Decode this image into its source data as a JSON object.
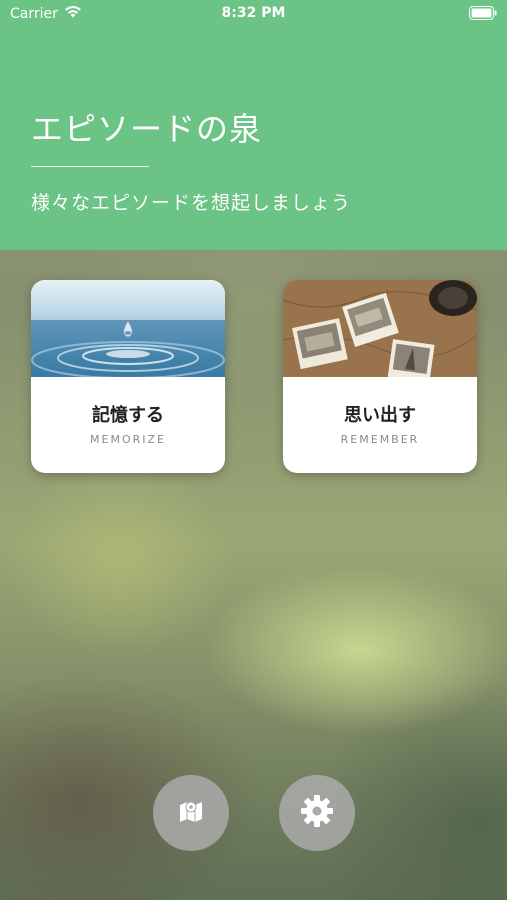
{
  "status_bar": {
    "carrier": "Carrier",
    "time": "8:32 PM"
  },
  "header": {
    "title": "エピソードの泉",
    "subtitle": "様々なエピソードを想起しましょう",
    "background_color": "#6bc386"
  },
  "cards": [
    {
      "title": "記憶する",
      "subtitle": "MEMORIZE",
      "image": "water-drop-photo"
    },
    {
      "title": "思い出す",
      "subtitle": "REMEMBER",
      "image": "photos-on-map-photo"
    }
  ],
  "bottom_buttons": [
    {
      "icon": "map-icon"
    },
    {
      "icon": "gear-icon"
    }
  ]
}
